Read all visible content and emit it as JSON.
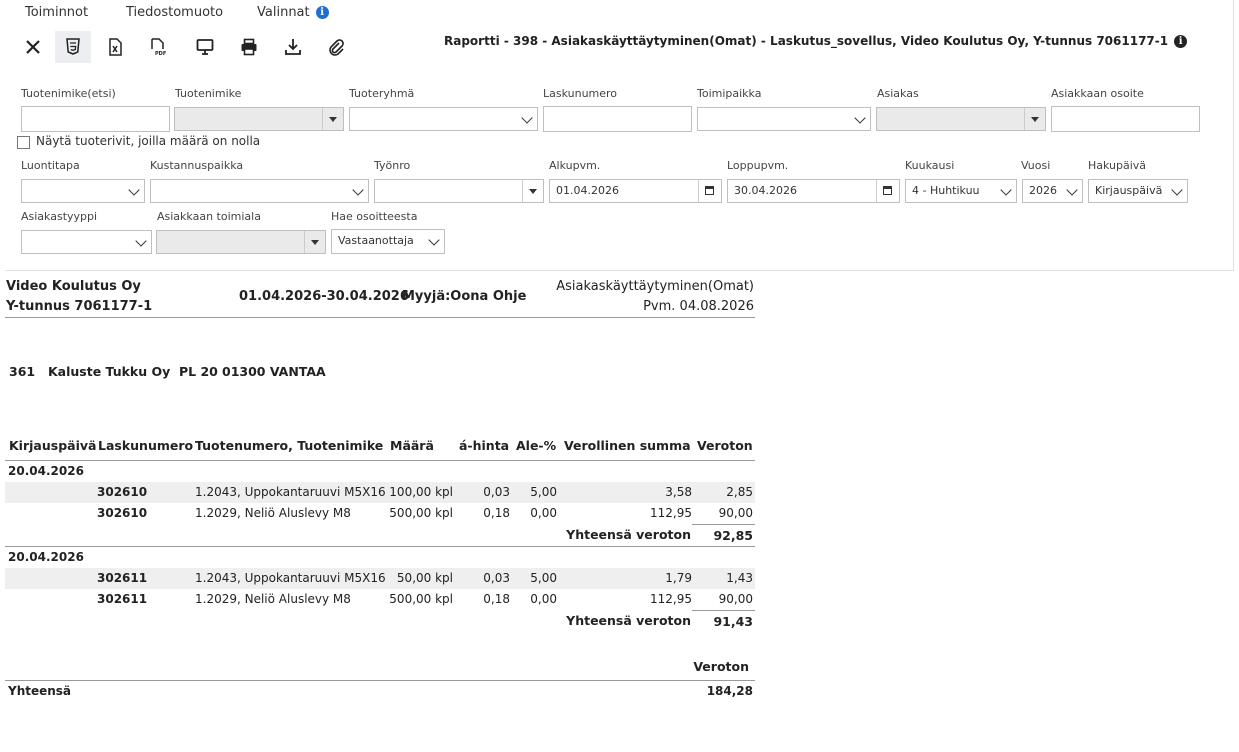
{
  "menu": {
    "toiminnot": "Toiminnot",
    "tiedostomuoto": "Tiedostomuoto",
    "valinnat": "Valinnat"
  },
  "report_title": "Raportti - 398 - Asiakaskäyttäytyminen(Omat) - Laskutus_sovellus, Video Koulutus Oy, Y-tunnus 7061177-1",
  "toolbar": [
    "close-icon",
    "html5-icon",
    "excel-icon",
    "pdf-icon",
    "screen-icon",
    "print-icon",
    "download-icon",
    "attachment-icon"
  ],
  "filters": {
    "tuotenimike_etsi": {
      "label": "Tuotenimike(etsi)",
      "value": ""
    },
    "tuotenimike": {
      "label": "Tuotenimike",
      "value": ""
    },
    "tuoteryhma": {
      "label": "Tuoteryhmä",
      "value": ""
    },
    "laskunumero": {
      "label": "Laskunumero",
      "value": ""
    },
    "toimipaikka": {
      "label": "Toimipaikka",
      "value": ""
    },
    "asiakas": {
      "label": "Asiakas",
      "value": ""
    },
    "asiakkaan_osoite": {
      "label": "Asiakkaan osoite",
      "value": ""
    },
    "nayta_nolla": "Näytä tuoterivit, joilla määrä on nolla",
    "luontitapa": {
      "label": "Luontitapa",
      "value": ""
    },
    "kustannuspaikka": {
      "label": "Kustannuspaikka",
      "value": ""
    },
    "tyonro": {
      "label": "Työnro",
      "value": ""
    },
    "alkupvm": {
      "label": "Alkupvm.",
      "value": "01.04.2026"
    },
    "loppupvm": {
      "label": "Loppupvm.",
      "value": "30.04.2026"
    },
    "kuukausi": {
      "label": "Kuukausi",
      "value": "4 - Huhtikuu"
    },
    "vuosi": {
      "label": "Vuosi",
      "value": "2026"
    },
    "hakupaiva": {
      "label": "Hakupäivä",
      "value": "Kirjauspäivä"
    },
    "asiakastyyppi": {
      "label": "Asiakastyyppi",
      "value": ""
    },
    "asiakkaan_toimiala": {
      "label": "Asiakkaan toimiala",
      "value": ""
    },
    "hae_osoitteesta": {
      "label": "Hae osoitteesta",
      "value": "Vastaanottaja"
    }
  },
  "report": {
    "company": "Video Koulutus Oy",
    "ytunnus": "Y-tunnus 7061177-1",
    "period": "01.04.2026-30.04.2026",
    "seller": "Myyjä:Oona Ohje",
    "report_name": "Asiakaskäyttäytyminen(Omat)",
    "pvm": "Pvm. 04.08.2026",
    "customer": {
      "id": "361",
      "name": "Kaluste Tukku Oy",
      "address": "PL 20",
      "postal": "01300 VANTAA"
    },
    "columns": [
      "Kirjauspäivä",
      "Laskunumero",
      "Tuotenumero, Tuotenimike",
      "Määrä",
      "á-hinta",
      "Ale-%",
      "Verollinen summa",
      "Veroton"
    ],
    "groups": [
      {
        "date": "20.04.2026",
        "rows": [
          {
            "invoice": "302610",
            "product": "1.2043, Uppokantaruuvi M5X16",
            "qty": "100,00 kpl",
            "price": "0,03",
            "discount": "5,00",
            "gross": "3,58",
            "net": "2,85"
          },
          {
            "invoice": "302610",
            "product": "1.2029, Neliö Aluslevy M8",
            "qty": "500,00 kpl",
            "price": "0,18",
            "discount": "0,00",
            "gross": "112,95",
            "net": "90,00"
          }
        ],
        "total_label": "Yhteensä veroton",
        "total": "92,85"
      },
      {
        "date": "20.04.2026",
        "rows": [
          {
            "invoice": "302611",
            "product": "1.2043, Uppokantaruuvi M5X16",
            "qty": "50,00 kpl",
            "price": "0,03",
            "discount": "5,00",
            "gross": "1,79",
            "net": "1,43"
          },
          {
            "invoice": "302611",
            "product": "1.2029, Neliö Aluslevy M8",
            "qty": "500,00 kpl",
            "price": "0,18",
            "discount": "0,00",
            "gross": "112,95",
            "net": "90,00"
          }
        ],
        "total_label": "Yhteensä veroton",
        "total": "91,43"
      }
    ],
    "grand_header": "Veroton",
    "grand_label": "Yhteensä",
    "grand_total": "184,28"
  }
}
